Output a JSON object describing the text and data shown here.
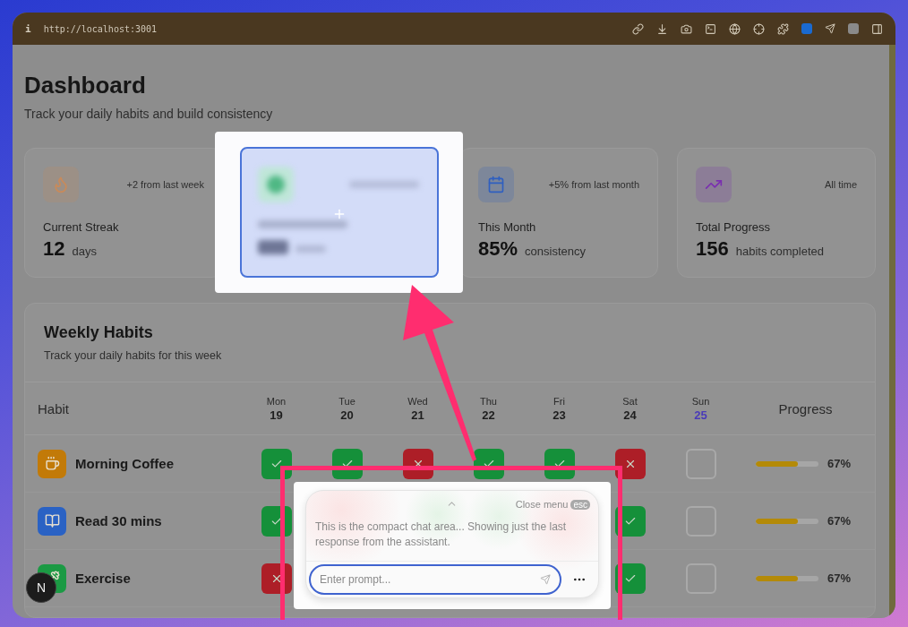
{
  "browser": {
    "info": "i",
    "url": "http://localhost:3001"
  },
  "page": {
    "title": "Dashboard",
    "subtitle": "Track your daily habits and build consistency"
  },
  "stats": [
    {
      "kind": "stat",
      "color": "#c98a5a",
      "label": "Current Streak",
      "value": "12",
      "unit": "days",
      "note": "+2 from last week"
    },
    {
      "kind": "capture"
    },
    {
      "kind": "stat",
      "color": "#2f5fc0",
      "label": "This Month",
      "value": "85%",
      "unit": "consistency",
      "note": "+5% from last month"
    },
    {
      "kind": "stat",
      "color": "#7a2fb0",
      "label": "Total Progress",
      "value": "156",
      "unit": "habits completed",
      "note": "All time"
    }
  ],
  "weekly": {
    "title": "Weekly Habits",
    "subtitle": "Track your daily habits for this week",
    "habit_header": "Habit",
    "progress_header": "Progress",
    "days": [
      {
        "day": "Mon",
        "date": "19",
        "today": false
      },
      {
        "day": "Tue",
        "date": "20",
        "today": false
      },
      {
        "day": "Wed",
        "date": "21",
        "today": false
      },
      {
        "day": "Thu",
        "date": "22",
        "today": false
      },
      {
        "day": "Fri",
        "date": "23",
        "today": false
      },
      {
        "day": "Sat",
        "date": "24",
        "today": false
      },
      {
        "day": "Sun",
        "date": "25",
        "today": true
      }
    ],
    "habits": [
      {
        "name": "Morning Coffee",
        "color": "#c27a08",
        "cells": [
          {
            "kind": "done"
          },
          {
            "kind": "done"
          },
          {
            "kind": "missed"
          },
          {
            "kind": "done"
          },
          {
            "kind": "done"
          },
          {
            "kind": "missed"
          },
          {
            "kind": "empty"
          }
        ],
        "level": 0.67,
        "percent": "67%"
      },
      {
        "name": "Read 30 mins",
        "color": "#2a62c4",
        "cells": [
          {
            "kind": "done"
          },
          null,
          null,
          null,
          null,
          {
            "kind": "done"
          },
          {
            "kind": "empty"
          }
        ],
        "level": 0.67,
        "percent": "67%"
      },
      {
        "name": "Exercise",
        "color": "#1b9a44",
        "cells": [
          {
            "kind": "missed"
          },
          null,
          null,
          null,
          null,
          {
            "kind": "done"
          },
          {
            "kind": "empty"
          }
        ],
        "level": 0.67,
        "percent": "67%"
      }
    ]
  },
  "chat": {
    "close_label": "Close menu",
    "esc_key": "esc",
    "message": "This is the compact chat area... Showing just the last response from the assistant.",
    "placeholder": "Enter prompt..."
  },
  "badge": {
    "letter": "N"
  }
}
